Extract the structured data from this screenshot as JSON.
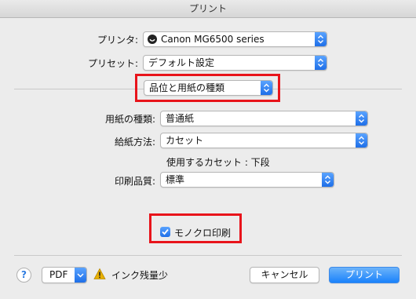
{
  "window": {
    "title": "プリント"
  },
  "printer": {
    "label": "プリンタ:",
    "value": "Canon MG6500 series",
    "icon": "printer-bonjour-icon"
  },
  "preset": {
    "label": "プリセット:",
    "value": "デフォルト設定"
  },
  "section": {
    "value": "品位と用紙の種類"
  },
  "paper_type": {
    "label": "用紙の種類:",
    "value": "普通紙"
  },
  "paper_source": {
    "label": "給紙方法:",
    "value": "カセット"
  },
  "cassette_info": "使用するカセット : 下段",
  "print_quality": {
    "label": "印刷品質:",
    "value": "標準"
  },
  "monochrome": {
    "label": "モノクロ印刷",
    "checked": true
  },
  "footer": {
    "help_label": "?",
    "pdf_label": "PDF",
    "warning_text": "インク残量少",
    "cancel_label": "キャンセル",
    "print_label": "プリント"
  },
  "colors": {
    "accent": "#1a82fb",
    "highlight_box": "#e8141b",
    "warning": "#e8b000"
  }
}
